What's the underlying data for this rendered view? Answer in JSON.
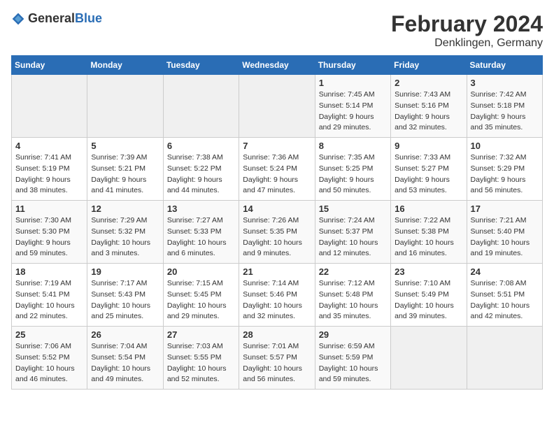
{
  "header": {
    "logo_general": "General",
    "logo_blue": "Blue",
    "month_title": "February 2024",
    "location": "Denklingen, Germany"
  },
  "days_of_week": [
    "Sunday",
    "Monday",
    "Tuesday",
    "Wednesday",
    "Thursday",
    "Friday",
    "Saturday"
  ],
  "weeks": [
    [
      {
        "day": "",
        "info": ""
      },
      {
        "day": "",
        "info": ""
      },
      {
        "day": "",
        "info": ""
      },
      {
        "day": "",
        "info": ""
      },
      {
        "day": "1",
        "info": "Sunrise: 7:45 AM\nSunset: 5:14 PM\nDaylight: 9 hours\nand 29 minutes."
      },
      {
        "day": "2",
        "info": "Sunrise: 7:43 AM\nSunset: 5:16 PM\nDaylight: 9 hours\nand 32 minutes."
      },
      {
        "day": "3",
        "info": "Sunrise: 7:42 AM\nSunset: 5:18 PM\nDaylight: 9 hours\nand 35 minutes."
      }
    ],
    [
      {
        "day": "4",
        "info": "Sunrise: 7:41 AM\nSunset: 5:19 PM\nDaylight: 9 hours\nand 38 minutes."
      },
      {
        "day": "5",
        "info": "Sunrise: 7:39 AM\nSunset: 5:21 PM\nDaylight: 9 hours\nand 41 minutes."
      },
      {
        "day": "6",
        "info": "Sunrise: 7:38 AM\nSunset: 5:22 PM\nDaylight: 9 hours\nand 44 minutes."
      },
      {
        "day": "7",
        "info": "Sunrise: 7:36 AM\nSunset: 5:24 PM\nDaylight: 9 hours\nand 47 minutes."
      },
      {
        "day": "8",
        "info": "Sunrise: 7:35 AM\nSunset: 5:25 PM\nDaylight: 9 hours\nand 50 minutes."
      },
      {
        "day": "9",
        "info": "Sunrise: 7:33 AM\nSunset: 5:27 PM\nDaylight: 9 hours\nand 53 minutes."
      },
      {
        "day": "10",
        "info": "Sunrise: 7:32 AM\nSunset: 5:29 PM\nDaylight: 9 hours\nand 56 minutes."
      }
    ],
    [
      {
        "day": "11",
        "info": "Sunrise: 7:30 AM\nSunset: 5:30 PM\nDaylight: 9 hours\nand 59 minutes."
      },
      {
        "day": "12",
        "info": "Sunrise: 7:29 AM\nSunset: 5:32 PM\nDaylight: 10 hours\nand 3 minutes."
      },
      {
        "day": "13",
        "info": "Sunrise: 7:27 AM\nSunset: 5:33 PM\nDaylight: 10 hours\nand 6 minutes."
      },
      {
        "day": "14",
        "info": "Sunrise: 7:26 AM\nSunset: 5:35 PM\nDaylight: 10 hours\nand 9 minutes."
      },
      {
        "day": "15",
        "info": "Sunrise: 7:24 AM\nSunset: 5:37 PM\nDaylight: 10 hours\nand 12 minutes."
      },
      {
        "day": "16",
        "info": "Sunrise: 7:22 AM\nSunset: 5:38 PM\nDaylight: 10 hours\nand 16 minutes."
      },
      {
        "day": "17",
        "info": "Sunrise: 7:21 AM\nSunset: 5:40 PM\nDaylight: 10 hours\nand 19 minutes."
      }
    ],
    [
      {
        "day": "18",
        "info": "Sunrise: 7:19 AM\nSunset: 5:41 PM\nDaylight: 10 hours\nand 22 minutes."
      },
      {
        "day": "19",
        "info": "Sunrise: 7:17 AM\nSunset: 5:43 PM\nDaylight: 10 hours\nand 25 minutes."
      },
      {
        "day": "20",
        "info": "Sunrise: 7:15 AM\nSunset: 5:45 PM\nDaylight: 10 hours\nand 29 minutes."
      },
      {
        "day": "21",
        "info": "Sunrise: 7:14 AM\nSunset: 5:46 PM\nDaylight: 10 hours\nand 32 minutes."
      },
      {
        "day": "22",
        "info": "Sunrise: 7:12 AM\nSunset: 5:48 PM\nDaylight: 10 hours\nand 35 minutes."
      },
      {
        "day": "23",
        "info": "Sunrise: 7:10 AM\nSunset: 5:49 PM\nDaylight: 10 hours\nand 39 minutes."
      },
      {
        "day": "24",
        "info": "Sunrise: 7:08 AM\nSunset: 5:51 PM\nDaylight: 10 hours\nand 42 minutes."
      }
    ],
    [
      {
        "day": "25",
        "info": "Sunrise: 7:06 AM\nSunset: 5:52 PM\nDaylight: 10 hours\nand 46 minutes."
      },
      {
        "day": "26",
        "info": "Sunrise: 7:04 AM\nSunset: 5:54 PM\nDaylight: 10 hours\nand 49 minutes."
      },
      {
        "day": "27",
        "info": "Sunrise: 7:03 AM\nSunset: 5:55 PM\nDaylight: 10 hours\nand 52 minutes."
      },
      {
        "day": "28",
        "info": "Sunrise: 7:01 AM\nSunset: 5:57 PM\nDaylight: 10 hours\nand 56 minutes."
      },
      {
        "day": "29",
        "info": "Sunrise: 6:59 AM\nSunset: 5:59 PM\nDaylight: 10 hours\nand 59 minutes."
      },
      {
        "day": "",
        "info": ""
      },
      {
        "day": "",
        "info": ""
      }
    ]
  ]
}
